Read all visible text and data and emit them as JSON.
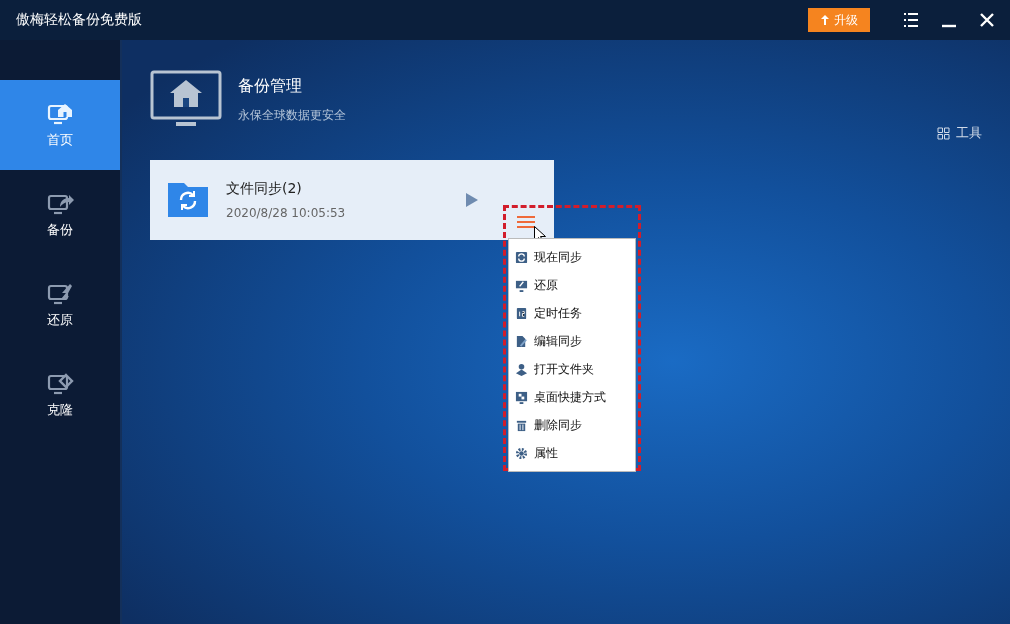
{
  "window": {
    "title": "傲梅轻松备份免费版",
    "upgrade_button": "升级"
  },
  "sidebar": {
    "items": [
      {
        "label": "首页",
        "kind": "home",
        "selected": true
      },
      {
        "label": "备份",
        "kind": "backup",
        "selected": false
      },
      {
        "label": "还原",
        "kind": "restore",
        "selected": false
      },
      {
        "label": "克隆",
        "kind": "clone",
        "selected": false
      }
    ]
  },
  "header": {
    "title": "备份管理",
    "subtitle": "永保全球数据更安全"
  },
  "tools_link": "工具",
  "task_card": {
    "name": "文件同步(2)",
    "time": "2020/8/28 10:05:53"
  },
  "context_menu": {
    "items": [
      {
        "label": "现在同步",
        "kind": "sync"
      },
      {
        "label": "还原",
        "kind": "restore"
      },
      {
        "label": "定时任务",
        "kind": "schedule"
      },
      {
        "label": "编辑同步",
        "kind": "edit"
      },
      {
        "label": "打开文件夹",
        "kind": "folder"
      },
      {
        "label": "桌面快捷方式",
        "kind": "shortcut"
      },
      {
        "label": "删除同步",
        "kind": "delete"
      },
      {
        "label": "属性",
        "kind": "properties"
      }
    ]
  }
}
